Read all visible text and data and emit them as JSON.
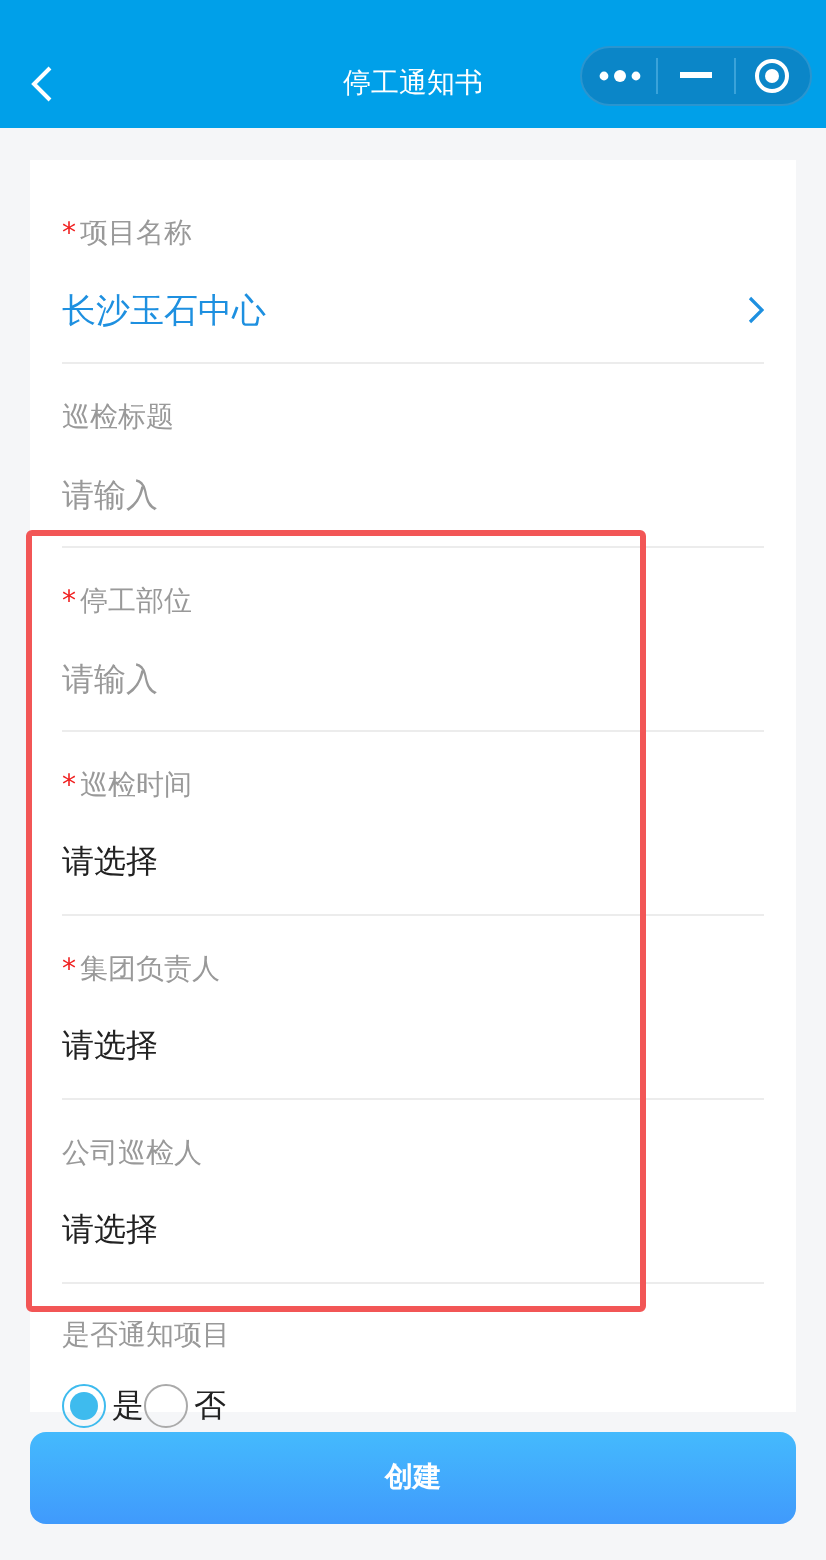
{
  "nav": {
    "title": "停工通知书"
  },
  "fields": [
    {
      "label": "项目名称",
      "mark": "*",
      "kind": "picker",
      "value": "长沙玉石中心",
      "highlighted": false
    },
    {
      "label": "巡检标题",
      "kind": "input",
      "placeholder": "请输入",
      "highlighted": false
    },
    {
      "label": "停工部位",
      "mark": "*",
      "kind": "input",
      "placeholder": "请输入",
      "highlighted": true
    },
    {
      "label": "巡检时间",
      "mark": "*",
      "kind": "select",
      "value": "请选择",
      "highlighted": true
    },
    {
      "label": "集团负责人",
      "mark": "*",
      "kind": "select",
      "value": "请选择",
      "highlighted": true
    },
    {
      "label": "公司巡检人",
      "kind": "select",
      "value": "请选择",
      "highlighted": true
    }
  ],
  "notify": {
    "label": "是否通知项目",
    "options": [
      {
        "label": "是",
        "selected": true
      },
      {
        "label": "否",
        "selected": false
      }
    ]
  },
  "submit": {
    "label": "创建"
  }
}
